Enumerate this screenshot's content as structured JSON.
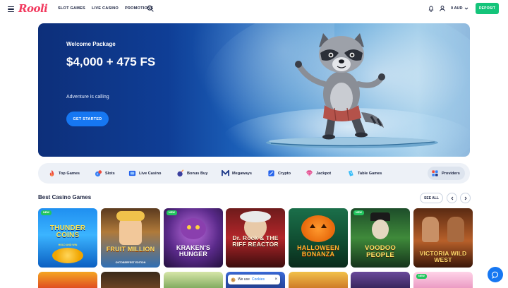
{
  "brand": {
    "logo_text": "Rooli",
    "accent": "#f23a5f"
  },
  "header": {
    "nav": [
      "SLOT GAMES",
      "LIVE CASINO",
      "PROMOTIONS"
    ],
    "balance": "0 AUD",
    "deposit_label": "DEPOSIT",
    "deposit_color": "#14c47a"
  },
  "hero": {
    "kicker": "Welcome Package",
    "amount": "$4,000 + 475 FS",
    "subtitle": "Adventure is calling",
    "cta": "GET STARTED",
    "cta_color": "#1677f2"
  },
  "categories": [
    {
      "label": "Top Games",
      "icon": "flame-icon"
    },
    {
      "label": "Slots",
      "icon": "slots-icon"
    },
    {
      "label": "Live Casino",
      "icon": "live-casino-icon"
    },
    {
      "label": "Bonus Buy",
      "icon": "bomb-icon"
    },
    {
      "label": "Megaways",
      "icon": "megaways-icon"
    },
    {
      "label": "Crypto",
      "icon": "crypto-icon"
    },
    {
      "label": "Jackpot",
      "icon": "diamond-icon"
    },
    {
      "label": "Table Games",
      "icon": "table-games-icon"
    },
    {
      "label": "Providers",
      "icon": "providers-icon"
    }
  ],
  "section": {
    "title": "Best Casino Games",
    "see_all": "SEE ALL"
  },
  "games": [
    {
      "title": "THUNDER COINS",
      "subtitle": "HOLD AND WIN",
      "badge": "NEW"
    },
    {
      "title": "FRUIT MILLION",
      "subtitle": "OKTOBERFEST EDITION",
      "badge": ""
    },
    {
      "title": "KRAKEN'S HUNGER",
      "subtitle": "",
      "badge": "NEW"
    },
    {
      "title": "Dr. Rock & THE RIFF REACTOR",
      "subtitle": "",
      "badge": ""
    },
    {
      "title": "HALLOWEEN BONANZA",
      "subtitle": "",
      "badge": ""
    },
    {
      "title": "VOODOO PEOPLE",
      "subtitle": "",
      "badge": "NEW"
    },
    {
      "title": "VICTORIA WILD WEST",
      "subtitle": "",
      "badge": ""
    }
  ],
  "row2_badge": "NEW",
  "cookie": {
    "text": "We use",
    "link": "Cookies"
  }
}
